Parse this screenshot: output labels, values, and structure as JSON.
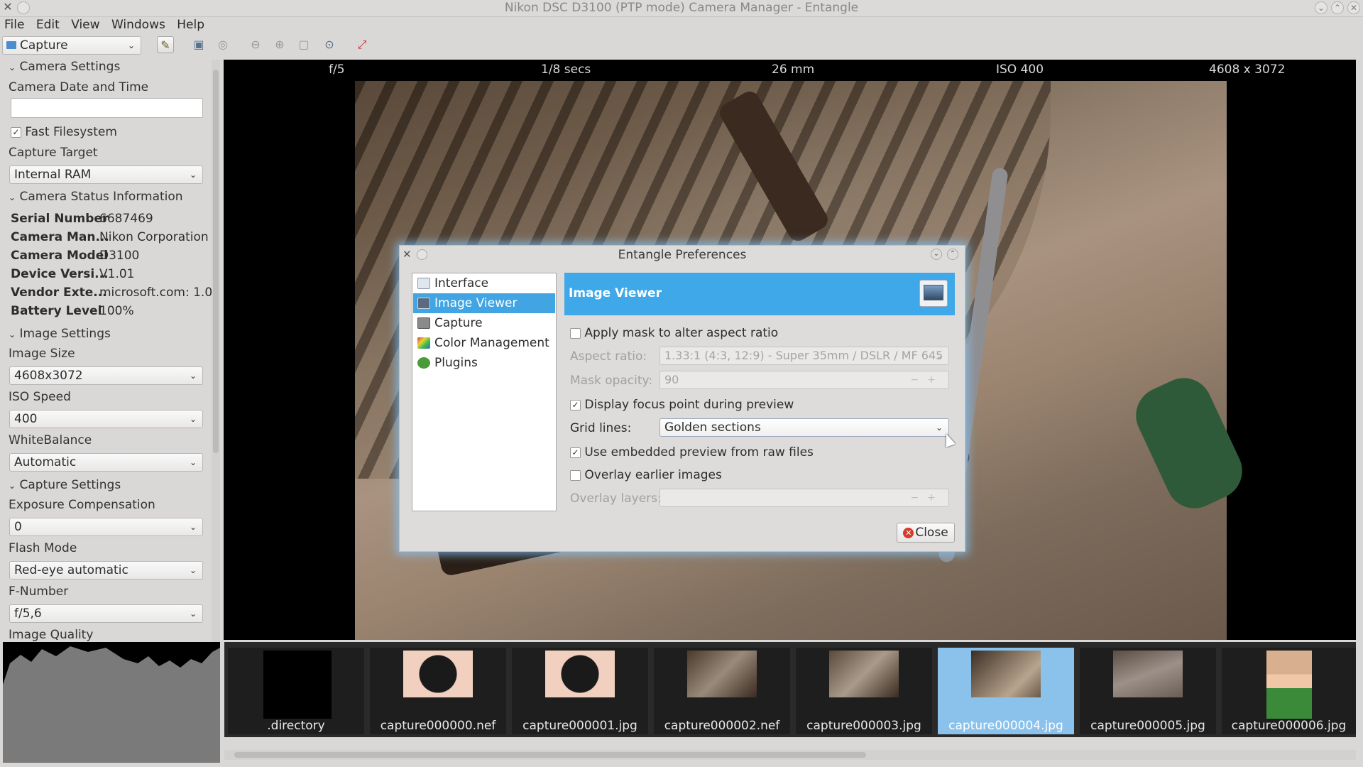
{
  "window": {
    "title": "Nikon DSC D3100 (PTP mode) Camera Manager - Entangle"
  },
  "menu": [
    "File",
    "Edit",
    "View",
    "Windows",
    "Help"
  ],
  "toolbar": {
    "mode_selected": "Capture",
    "icons": [
      "preferences-icon",
      "capture-icon",
      "preview-icon",
      "zoom-out-icon",
      "zoom-in-icon",
      "zoom-normal-icon",
      "zoom-best-icon",
      "fullscreen-icon"
    ]
  },
  "sidebar": {
    "camera_settings_header": "Camera Settings",
    "camera_date_label": "Camera Date and Time",
    "camera_date_value": "",
    "fast_fs_label": "Fast Filesystem",
    "fast_fs_checked": true,
    "capture_target_label": "Capture Target",
    "capture_target_value": "Internal RAM",
    "status_header": "Camera Status Information",
    "status": [
      {
        "key": "Serial Number",
        "value": "6687469"
      },
      {
        "key": "Camera Man...",
        "value": "Nikon Corporation"
      },
      {
        "key": "Camera Model",
        "value": "D3100"
      },
      {
        "key": "Device Versi...",
        "value": "V1.01"
      },
      {
        "key": "Vendor Exte...",
        "value": "microsoft.com: 1.0"
      },
      {
        "key": "Battery Level",
        "value": "100%"
      }
    ],
    "image_settings_header": "Image Settings",
    "image_size_label": "Image Size",
    "image_size_value": "4608x3072",
    "iso_label": "ISO Speed",
    "iso_value": "400",
    "wb_label": "WhiteBalance",
    "wb_value": "Automatic",
    "capture_settings_header": "Capture Settings",
    "exposure_label": "Exposure Compensation",
    "exposure_value": "0",
    "flash_label": "Flash Mode",
    "flash_value": "Red-eye automatic",
    "fnumber_label": "F-Number",
    "fnumber_value": "f/5,6",
    "quality_label": "Image Quality"
  },
  "infobar": {
    "aperture": "f/5",
    "shutter": "1/8 secs",
    "focal": "26 mm",
    "iso": "ISO 400",
    "resolution": "4608 x 3072"
  },
  "filmstrip": [
    {
      "name": ".directory",
      "selected": false
    },
    {
      "name": "capture000000.nef",
      "selected": false
    },
    {
      "name": "capture000001.jpg",
      "selected": false
    },
    {
      "name": "capture000002.nef",
      "selected": false
    },
    {
      "name": "capture000003.jpg",
      "selected": false
    },
    {
      "name": "capture000004.jpg",
      "selected": true
    },
    {
      "name": "capture000005.jpg",
      "selected": false
    },
    {
      "name": "capture000006.jpg",
      "selected": false
    }
  ],
  "dialog": {
    "title": "Entangle Preferences",
    "categories": [
      {
        "label": "Interface",
        "selected": false
      },
      {
        "label": "Image Viewer",
        "selected": true
      },
      {
        "label": "Capture",
        "selected": false
      },
      {
        "label": "Color Management",
        "selected": false
      },
      {
        "label": "Plugins",
        "selected": false
      }
    ],
    "page_title": "Image Viewer",
    "mask_label": "Apply mask to alter aspect ratio",
    "mask_checked": false,
    "aspect_label": "Aspect ratio:",
    "aspect_value": "1.33:1 (4:3, 12:9) - Super 35mm / DSLR / MF 645",
    "opacity_label": "Mask opacity:",
    "opacity_value": "90",
    "focus_label": "Display focus point during preview",
    "focus_checked": true,
    "grid_label": "Grid lines:",
    "grid_value": "Golden sections",
    "embedded_label": "Use embedded preview from raw files",
    "embedded_checked": true,
    "overlay_label": "Overlay earlier images",
    "overlay_checked": false,
    "overlay_layers_label": "Overlay layers:",
    "overlay_layers_value": "",
    "close_label": "Close"
  }
}
